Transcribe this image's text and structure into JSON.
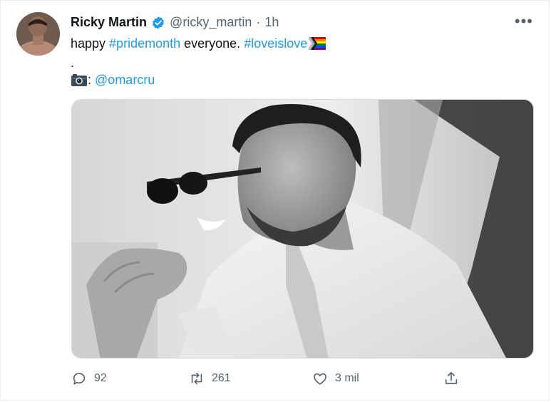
{
  "author": {
    "name": "Ricky Martin",
    "handle": "@ricky_martin",
    "separator": "·",
    "time": "1h"
  },
  "tweet": {
    "line1_prefix": "happy ",
    "hashtag1": "#pridemonth",
    "line1_middle": " everyone. ",
    "hashtag2": "#loveislove",
    "line2": ".",
    "line3_suffix": ":",
    "mention": "@omarcru"
  },
  "menu": {
    "more_label": "•••"
  },
  "actions": {
    "reply_count": "92",
    "retweet_count": "261",
    "like_count": "3 mil"
  },
  "icons": {
    "verified": "verified-badge-icon",
    "flag": "progress-pride-flag-icon",
    "camera": "camera-icon",
    "reply": "reply-icon",
    "retweet": "retweet-icon",
    "like": "heart-icon",
    "share": "share-icon"
  },
  "colors": {
    "link": "#1d9bf0",
    "secondary_text": "#536471",
    "primary_text": "#0f1419",
    "border": "#cfd9de"
  }
}
